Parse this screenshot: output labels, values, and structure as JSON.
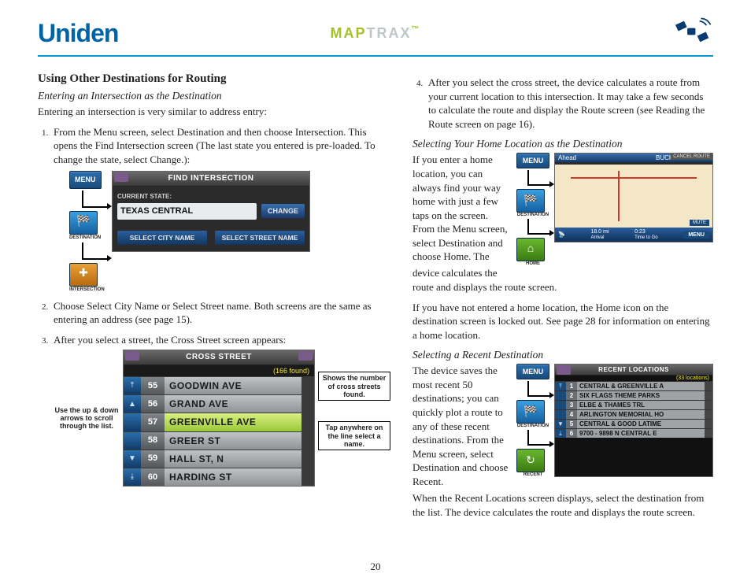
{
  "header": {
    "logo": "Uniden",
    "product1": "MAP",
    "product2": "TRAX"
  },
  "left": {
    "title": "Using Other Destinations for Routing",
    "sub1": "Entering an Intersection as the Destination",
    "intro": "Entering an intersection is very similar to address entry:",
    "step1": "From the Menu screen, select Destination and then choose Intersection. This opens the Find Intersection screen (The last state you entered is pre-loaded. To change the state, select Change.):",
    "step2": "Choose Select City Name or Select Street name. Both screens are the same as entering an address (see page 15).",
    "step3": "After you select a street, the Cross Street screen appears:",
    "fig1": {
      "menu": "MENU",
      "dest_lbl": "DESTINATION",
      "inter_lbl": "INTERSECTION",
      "title": "FIND INTERSECTION",
      "current_state_lbl": "CURRENT STATE:",
      "state": "TEXAS CENTRAL",
      "change": "CHANGE",
      "select_city": "SELECT CITY NAME",
      "select_street": "SELECT STREET NAME"
    },
    "fig2": {
      "note_left": "Use the up & down arrows to scroll through the list.",
      "note_r1": "Shows the number of cross streets found.",
      "note_r2": "Tap anywhere on the line select a name.",
      "title": "CROSS STREET",
      "found": "(166 found)",
      "rows": [
        {
          "n": "55",
          "s": "GOODWIN AVE"
        },
        {
          "n": "56",
          "s": "GRAND AVE"
        },
        {
          "n": "57",
          "s": "GREENVILLE AVE"
        },
        {
          "n": "58",
          "s": "GREER ST"
        },
        {
          "n": "59",
          "s": "HALL ST, N"
        },
        {
          "n": "60",
          "s": "HARDING ST"
        }
      ]
    }
  },
  "right": {
    "step4": "After you select the cross street, the device calculates a route from your current location to this intersection. It may take a few seconds to calculate the route and display the Route screen (see Reading the Route screen on page 16).",
    "sub2": "Selecting Your Home Location as the Destination",
    "home_p1": "If you enter a home location, you can always find your way home with just a few taps on the screen. From the Menu screen, select Destination and choose Home. The",
    "home_p2": "device calculates the route and displays the route screen.",
    "home_p3": "If you have not entered a home location, the Home icon on the destination screen is locked out. See page 28 for information on entering a home location.",
    "sub3": "Selecting a Recent Destination",
    "recent_p1": "The device saves the most recent 50 destinations; you can quickly plot a route to any of these recent destinations. From the Menu screen, select Destination and choose Recent.",
    "recent_p2": "When the Recent Locations screen displays, select the destination from the list. The device calculates the route and displays the route screen.",
    "fig3": {
      "menu": "MENU",
      "dest_lbl": "DESTINATION",
      "home_lbl": "HOME",
      "ahead": "Ahead",
      "road": "BUCKINGHAM RD",
      "cancel": "CANCEL ROUTE",
      "mute": "MUTE",
      "dist": "18.0 mi",
      "arrival": "Arrival",
      "ttg": "0:23",
      "ttg_lbl": "Time to Go",
      "menu_b": "MENU"
    },
    "fig4": {
      "menu": "MENU",
      "dest_lbl": "DESTINATION",
      "recent_lbl": "RECENT",
      "title": "RECENT LOCATIONS",
      "found": "(33 locations)",
      "rows": [
        {
          "n": "1",
          "s": "CENTRAL & GREENVILLE A"
        },
        {
          "n": "2",
          "s": "SIX FLAGS THEME PARKS"
        },
        {
          "n": "3",
          "s": "ELBE & THAMES TRL"
        },
        {
          "n": "4",
          "s": "ARLINGTON MEMORIAL HO"
        },
        {
          "n": "5",
          "s": "CENTRAL & GOOD LATIME"
        },
        {
          "n": "6",
          "s": "9700 - 9898 N CENTRAL E"
        }
      ]
    }
  },
  "page_number": "20"
}
